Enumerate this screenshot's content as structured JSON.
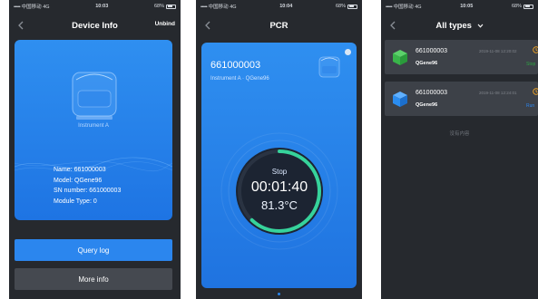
{
  "status_bar": {
    "carrier_signal": "•••••",
    "carrier": "中国移动",
    "network": "4G",
    "battery": "68%",
    "battery_icon": "battery-icon",
    "signal_icon": "signal-dots-icon"
  },
  "screen1": {
    "time": "10:03",
    "title": "Device Info",
    "right_action": "Unbind",
    "instrument_name": "Instrument A",
    "info": [
      {
        "label": "Name: ",
        "value": "661000003"
      },
      {
        "label": "Model: ",
        "value": "QGene96"
      },
      {
        "label": "SN number: ",
        "value": "661000003"
      },
      {
        "label": "Module Type: ",
        "value": "0"
      }
    ],
    "query_log_label": "Query log",
    "more_info_label": "More info"
  },
  "screen2": {
    "time": "10:04",
    "title": "PCR",
    "device_id": "661000003",
    "subtitle": "Instrument A · QGene96",
    "status": "Stop",
    "timer": "00:01:40",
    "temperature": "81.3°C",
    "ring_progress": 0.62
  },
  "screen3": {
    "time": "10:05",
    "title": "All types",
    "devices": [
      {
        "id": "661000003",
        "model": "QGene96",
        "timestamp": "2019-11-08 12:20:02",
        "status": "Stop",
        "status_color": "#2ea343",
        "cube_color": "#39b54a",
        "cube_icon": "green-cube-icon"
      },
      {
        "id": "661000003",
        "model": "QGene96",
        "timestamp": "2019-11-08 12:24:01",
        "status": "Run",
        "status_color": "#2b86ee",
        "cube_color": "#2b8df0",
        "cube_icon": "blue-cube-icon"
      }
    ],
    "empty_text": "没有内容",
    "warning_color": "#f5a623"
  },
  "colors": {
    "background": "#26292e",
    "accent": "#2b86ee",
    "card_gradient_top": "#2f8ff0",
    "card_gradient_bottom": "#1e74e3",
    "ring_green": "#36d39b",
    "ring_blue": "#4cb6ff"
  }
}
